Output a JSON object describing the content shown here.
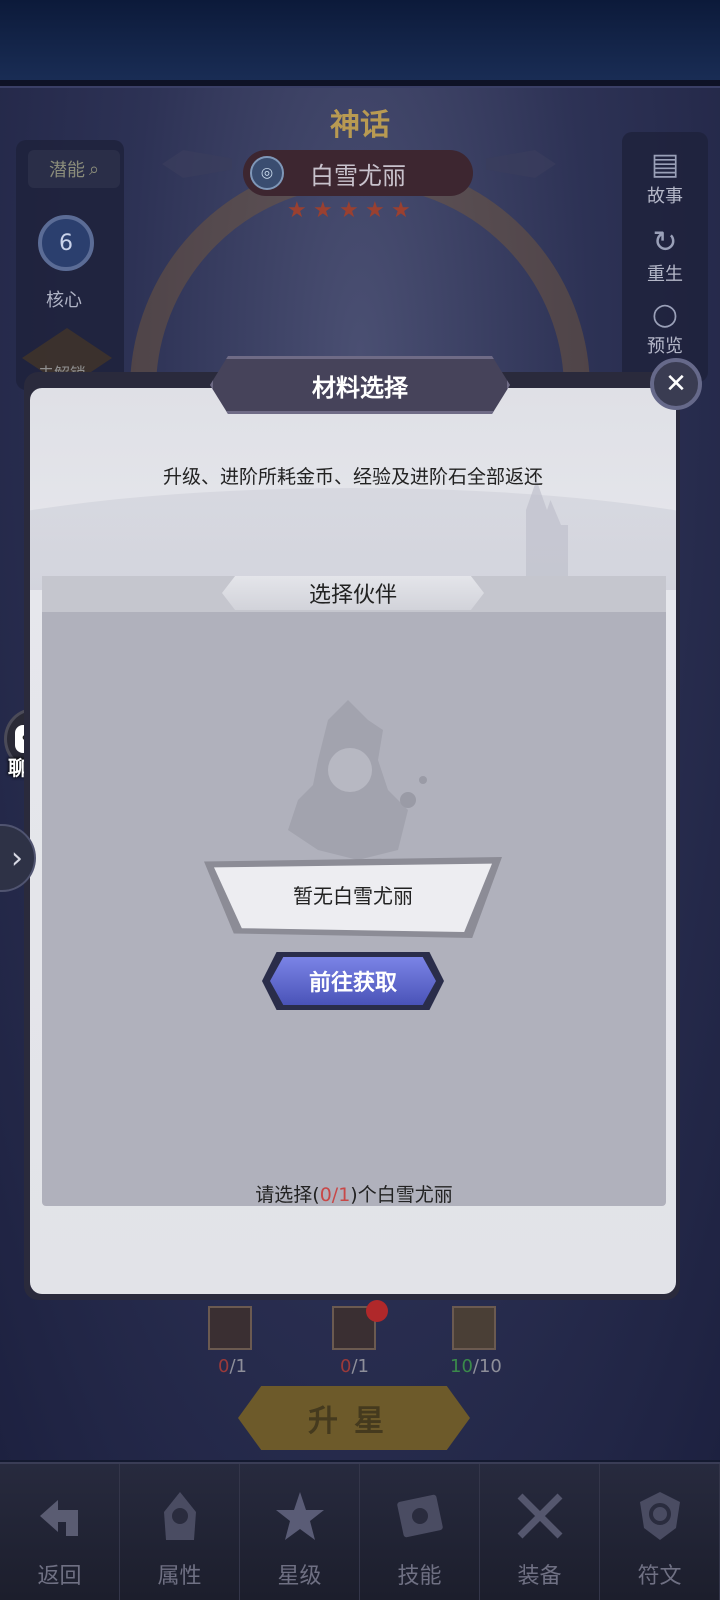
{
  "header": {
    "rarity": "神话",
    "hero_name": "白雪尤丽",
    "element_badge": "◎",
    "stars": [
      "★",
      "★",
      "★",
      "★",
      "★"
    ]
  },
  "left_panel": {
    "potential_label": "潜能",
    "core_level": "6",
    "core_label": "核心",
    "locked_label": "未解锁"
  },
  "right_panel": {
    "story_label": "故事",
    "rebirth_label": "重生",
    "preview_label": "预览"
  },
  "chat": {
    "label": "聊 天",
    "bubble": "•••"
  },
  "modal": {
    "title": "材料选择",
    "close_symbol": "✕",
    "refund_note": "升级、进阶所耗金币、经验及进阶石全部返还",
    "select_title": "选择伙伴",
    "empty_text": "暂无白雪尤丽",
    "obtain_button": "前往获取",
    "select_prefix": "请选择(",
    "select_count": "0/1",
    "select_suffix": ")个白雪尤丽"
  },
  "materials": [
    {
      "have": "0",
      "need": "/1"
    },
    {
      "have": "0",
      "need": "/1"
    },
    {
      "have": "10",
      "need": "/10"
    }
  ],
  "star_up_button": "升星",
  "bottom_tabs": [
    {
      "label": "返回",
      "icon": "back-icon"
    },
    {
      "label": "属性",
      "icon": "hooded-figure-icon"
    },
    {
      "label": "星级",
      "icon": "star-emblem-icon"
    },
    {
      "label": "技能",
      "icon": "spellbook-icon"
    },
    {
      "label": "装备",
      "icon": "crossed-swords-icon"
    },
    {
      "label": "符文",
      "icon": "rune-shield-icon"
    }
  ],
  "colors": {
    "accent_blue": "#5a63cc",
    "gold": "#b89a52",
    "red": "#c84848",
    "green": "#3a8a4a"
  }
}
